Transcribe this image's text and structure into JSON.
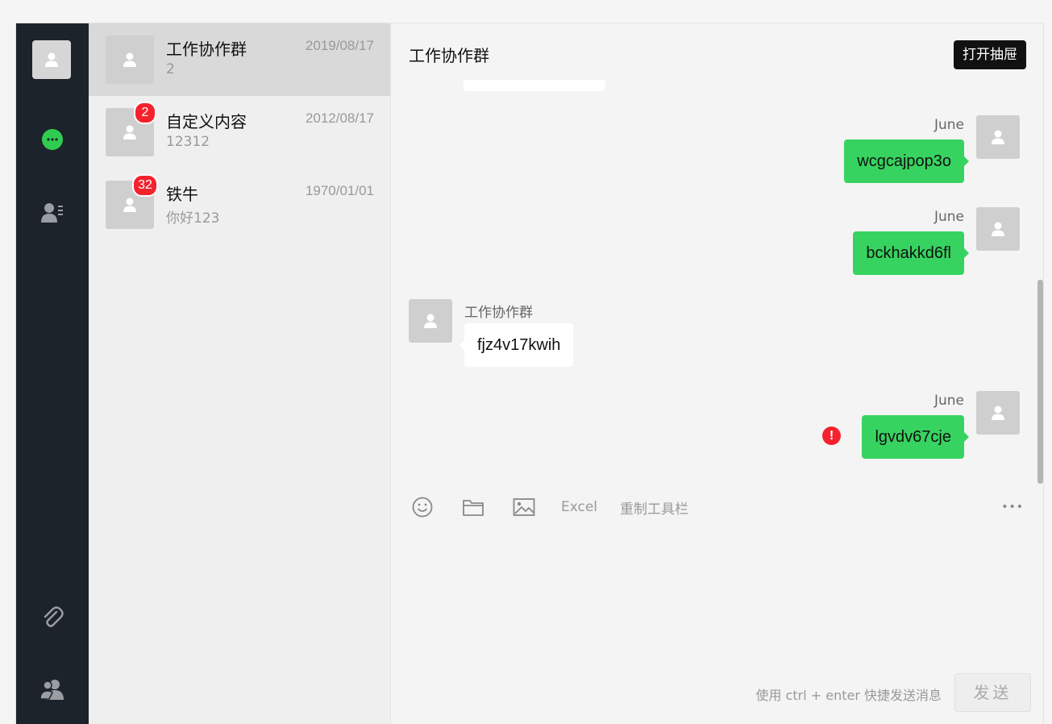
{
  "sidebar": {
    "avatar_icon": "user-icon",
    "items": [
      {
        "name": "chat-icon",
        "active": true
      },
      {
        "name": "contacts-icon",
        "active": false
      },
      {
        "name": "paperclip-icon",
        "active": false
      },
      {
        "name": "users-icon",
        "active": false
      }
    ]
  },
  "conversations": [
    {
      "name": "工作协作群",
      "last": "2",
      "date": "2019/08/17",
      "badge": ""
    },
    {
      "name": "自定义内容",
      "last": "12312",
      "date": "2012/08/17",
      "badge": "2"
    },
    {
      "name": "铁牛",
      "last": "你好123",
      "date": "1970/01/01",
      "badge": "32"
    }
  ],
  "chat": {
    "title": "工作协作群",
    "drawer_button": "打开抽屉",
    "messages": [
      {
        "sender": "June",
        "text": "wcgcajpop3o",
        "mine": true
      },
      {
        "sender": "June",
        "text": "bckhakkd6fl",
        "mine": true
      },
      {
        "sender": "工作协作群",
        "text": "fjz4v17kwih",
        "mine": false
      },
      {
        "sender": "June",
        "text": "lgvdv67cje",
        "mine": true,
        "error": "!"
      }
    ],
    "toolbar": {
      "excel": "Excel",
      "reset": "重制工具栏",
      "more": "•••"
    },
    "hint": "使用 ctrl + enter 快捷发送消息",
    "send": "发送"
  },
  "colors": {
    "accent": "#37d360",
    "badge": "#f5222d",
    "sidebar": "#1d232a"
  }
}
